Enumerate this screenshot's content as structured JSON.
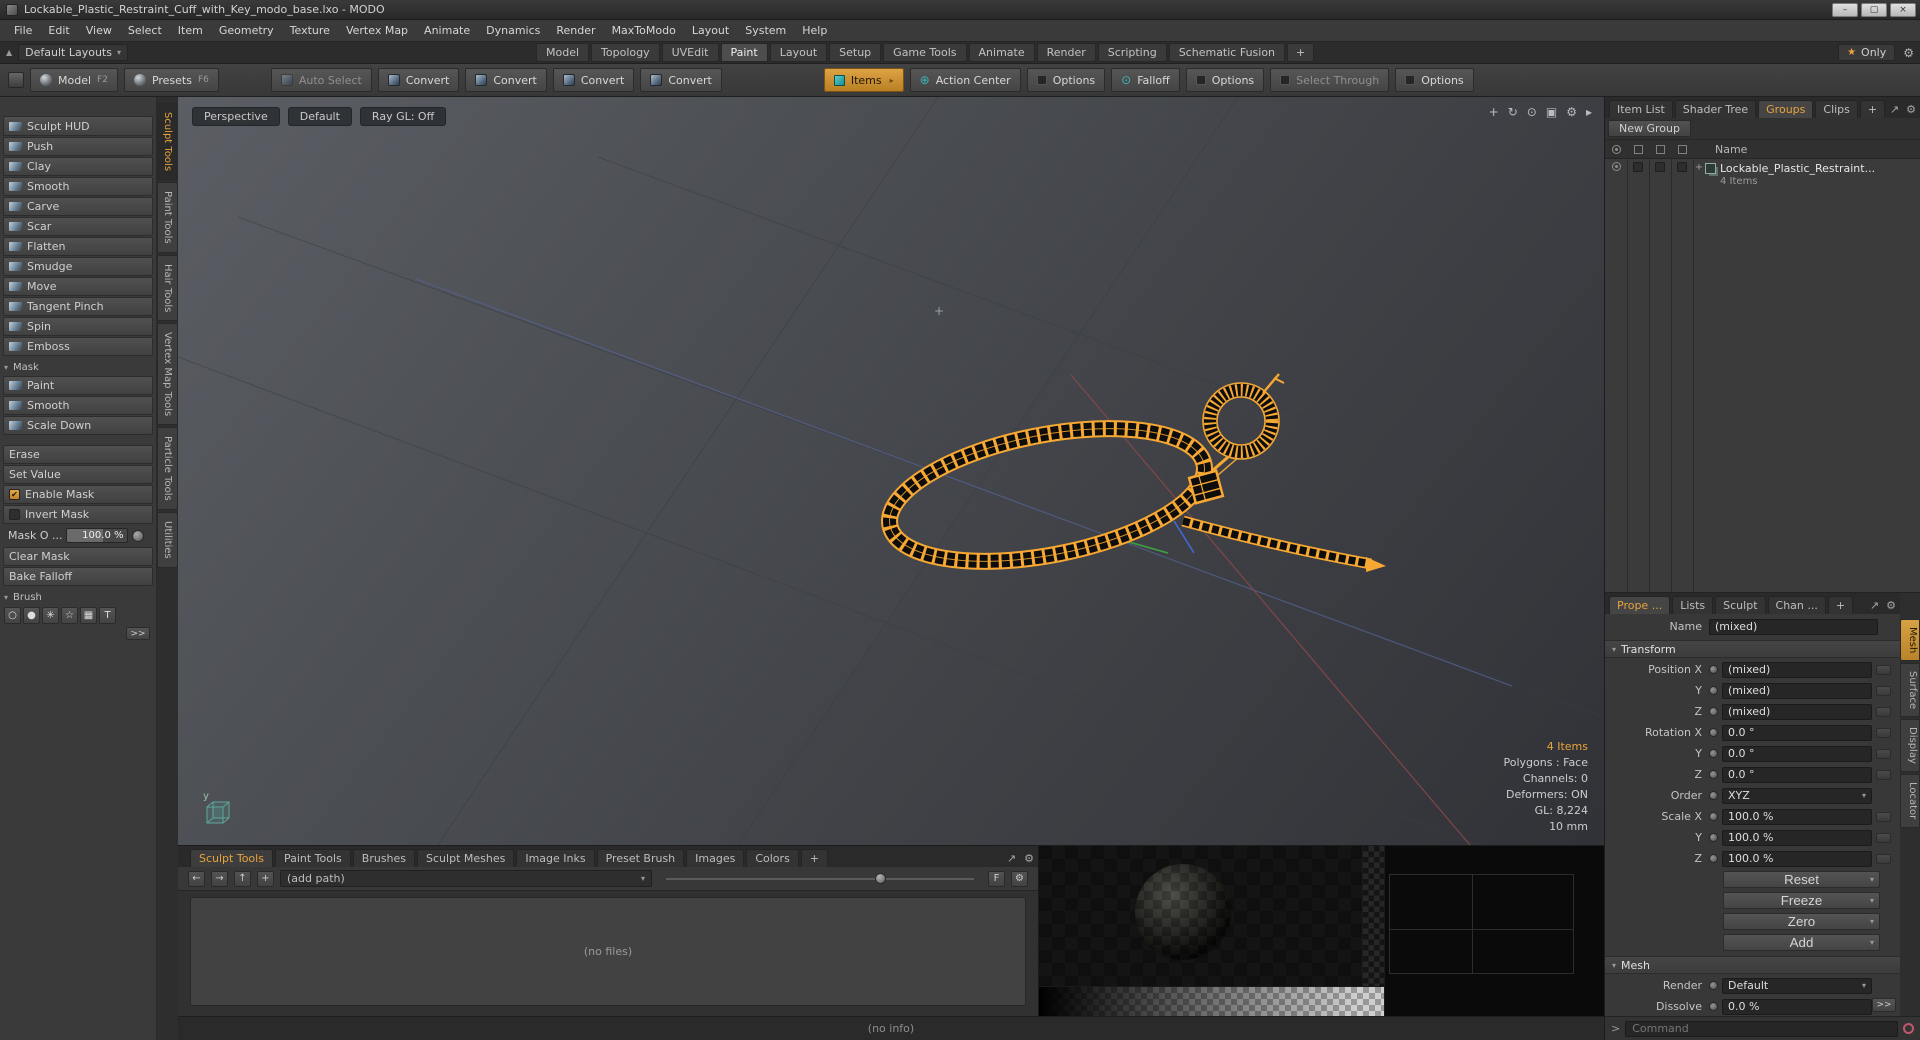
{
  "window": {
    "title": "Lockable_Plastic_Restraint_Cuff_with_Key_modo_base.lxo - MODO"
  },
  "icons": {
    "dropdown": "▾",
    "arrow_right": "▸",
    "star": "★",
    "gear": "⚙",
    "plus": "+",
    "expand": "↗",
    "back": "←",
    "forward": "→",
    "up": "↑",
    "check": "✔",
    "target": "⊕",
    "falloff_glyph": "⊙",
    "min": "–",
    "max": "▢",
    "close": "×",
    "home": "▲",
    "vp_icons": [
      "+",
      "↻",
      "⊙",
      "▣",
      "⚙",
      "▸"
    ],
    "brush_row": [
      "○",
      "●",
      "✳",
      "☆",
      "▦",
      "T"
    ]
  },
  "menubar": {
    "items": [
      "File",
      "Edit",
      "View",
      "Select",
      "Item",
      "Geometry",
      "Texture",
      "Vertex Map",
      "Animate",
      "Dynamics",
      "Render",
      "MaxToModo",
      "Layout",
      "System",
      "Help"
    ]
  },
  "layout_bar": {
    "label": "Default Layouts",
    "tabs": [
      "Model",
      "Topology",
      "UVEdit",
      "Paint",
      "Layout",
      "Setup",
      "Game Tools",
      "Animate",
      "Render",
      "Scripting",
      "Schematic Fusion"
    ],
    "plus": "+",
    "only": "Only"
  },
  "toolbar": {
    "model_label": "Model",
    "model_key": "F2",
    "presets_label": "Presets",
    "presets_key": "F6",
    "auto_select": "Auto Select",
    "convert": "Convert",
    "items": "Items",
    "action_center": "Action Center",
    "options": "Options",
    "falloff": "Falloff",
    "select_through": "Select Through"
  },
  "left_tabs": {
    "items": [
      "Sculpt Tools",
      "Paint Tools",
      "Hair Tools",
      "Vertex Map Tools",
      "Particle Tools",
      "Utilities"
    ]
  },
  "sculpt_panel": {
    "header": "Sculpt HUD",
    "tools": [
      "Push",
      "Clay",
      "Smooth",
      "Carve",
      "Scar",
      "Flatten",
      "Smudge",
      "Move",
      "Tangent Pinch",
      "Spin",
      "Emboss"
    ],
    "mask_header": "Mask",
    "mask_tools": [
      "Paint",
      "Smooth",
      "Scale Down"
    ],
    "tools2": [
      "Erase",
      "Set Value"
    ],
    "enable_mask": "Enable Mask",
    "invert_mask": "Invert Mask",
    "mask_opacity_label": "Mask O ...",
    "mask_opacity_value": "100.0 %",
    "clear_mask": "Clear Mask",
    "bake_falloff": "Bake Falloff",
    "brush_header": "Brush",
    "more": ">>"
  },
  "viewport": {
    "buttons": [
      "Perspective",
      "Default",
      "Ray GL: Off"
    ],
    "stats": [
      "4 Items",
      "Polygons : Face",
      "Channels: 0",
      "Deformers: ON",
      "GL: 8,224",
      "10 mm"
    ],
    "axis": "y",
    "marker": "+"
  },
  "groups_panel": {
    "tabs": [
      "Item List",
      "Shader Tree",
      "Groups",
      "Clips"
    ],
    "plus": "+",
    "new_group": "New Group",
    "name_header": "Name",
    "item_name": "Lockable_Plastic_Restraint...",
    "item_count": "4 Items"
  },
  "properties": {
    "tabs": [
      "Prope ...",
      "Lists",
      "Sculpt",
      "Chan ..."
    ],
    "plus": "+",
    "name_label": "Name",
    "name_value": "(mixed)",
    "transform": "Transform",
    "rows": [
      {
        "label": "Position X",
        "value": "(mixed)"
      },
      {
        "label": "Y",
        "value": "(mixed)"
      },
      {
        "label": "Z",
        "value": "(mixed)"
      },
      {
        "label": "Rotation X",
        "value": "0.0 °"
      },
      {
        "label": "Y",
        "value": "0.0 °"
      },
      {
        "label": "Z",
        "value": "0.0 °"
      }
    ],
    "order_label": "Order",
    "order_value": "XYZ",
    "scale_rows": [
      {
        "label": "Scale X",
        "value": "100.0 %"
      },
      {
        "label": "Y",
        "value": "100.0 %"
      },
      {
        "label": "Z",
        "value": "100.0 %"
      }
    ],
    "action_buttons": [
      "Reset",
      "Freeze",
      "Zero",
      "Add"
    ],
    "mesh": "Mesh",
    "render_label": "Render",
    "render_value": "Default",
    "dissolve_label": "Dissolve",
    "dissolve_value": "0.0 %",
    "more": ">>",
    "vtabs": [
      "Mesh",
      "Surface",
      "Display",
      "Locator"
    ]
  },
  "bottom_panel": {
    "tabs": [
      "Sculpt Tools",
      "Paint Tools",
      "Brushes",
      "Sculpt Meshes",
      "Image Inks",
      "Preset Brush",
      "Images",
      "Colors"
    ],
    "plus": "+",
    "add_path": "(add path)",
    "no_files": "(no files)",
    "f": "F"
  },
  "statusbar": {
    "text": "(no info)"
  },
  "command": {
    "prompt": ">",
    "label": "Command"
  },
  "colors": {
    "accent": "#e8a33d",
    "teal": "#3ab5b5",
    "wireframe": "#f7a833"
  }
}
